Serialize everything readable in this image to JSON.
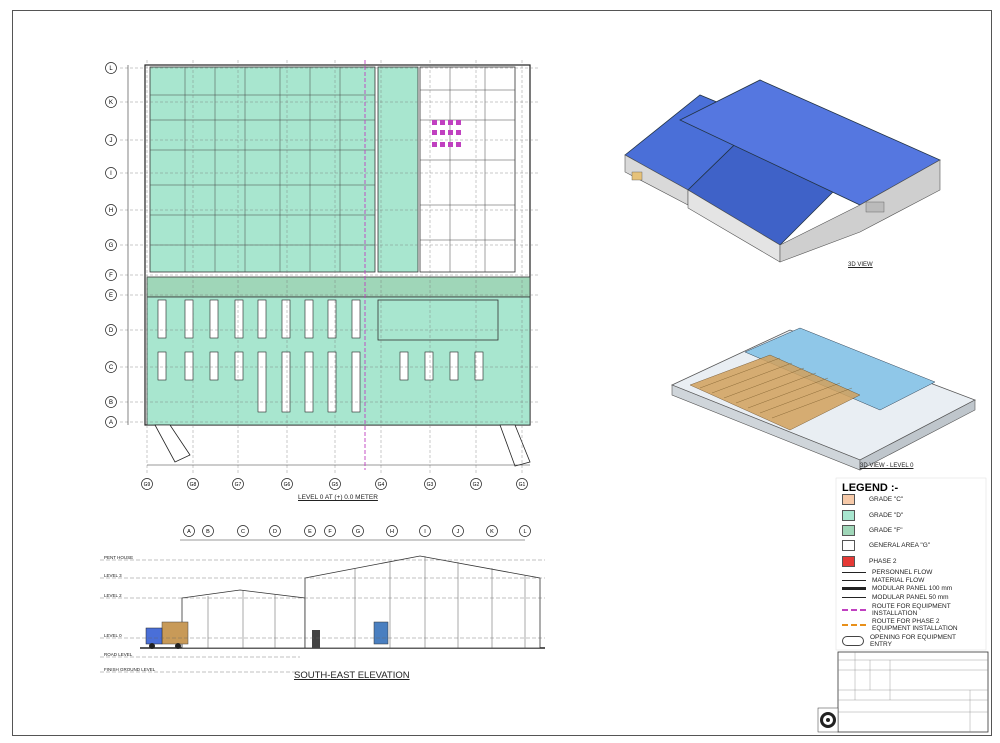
{
  "views": {
    "plan_title": "LEVEL 0 AT (+) 0.0 METER",
    "elevation_title": "SOUTH-EAST ELEVATION",
    "view_3d_title": "3D VIEW",
    "view_3d_level0_title": "3D VIEW - LEVEL 0"
  },
  "grid": {
    "rows": [
      "L",
      "K",
      "J",
      "I",
      "H",
      "G",
      "F",
      "E",
      "D",
      "C",
      "B",
      "A"
    ],
    "cols": [
      "G9",
      "G8",
      "G7",
      "G6",
      "G5",
      "G4",
      "G3",
      "G2",
      "G1"
    ],
    "elev_cols": [
      "A",
      "B",
      "C",
      "D",
      "E",
      "F",
      "G",
      "H",
      "I",
      "J",
      "K",
      "L"
    ]
  },
  "elevation_levels": [
    {
      "name": "PENT HOUSE"
    },
    {
      "name": "LEVEL 3"
    },
    {
      "name": "LEVEL 2"
    },
    {
      "name": "LEVEL 0"
    },
    {
      "name": "ROAD LEVEL"
    },
    {
      "name": "FINISH GROUND LEVEL"
    }
  ],
  "legend": {
    "title": "LEGEND :-",
    "fills": [
      {
        "label": "GRADE \"C\"",
        "color": "#f6c9a8"
      },
      {
        "label": "GRADE \"D\"",
        "color": "#a8e6cf"
      },
      {
        "label": "GRADE \"F\"",
        "color": "#9fd6b8"
      },
      {
        "label": "GENERAL AREA \"G\"",
        "color": "#ffffff"
      },
      {
        "label": "PHASE 2",
        "color": "#e53935"
      }
    ],
    "lines": [
      {
        "label": "PERSONNEL FLOW",
        "style": "arrow"
      },
      {
        "label": "MATERIAL FLOW",
        "style": "arrow"
      },
      {
        "label": "MODULAR PANEL 100 mm",
        "style": "thick"
      },
      {
        "label": "MODULAR PANEL 50 mm",
        "style": "thin"
      },
      {
        "label": "ROUTE FOR EQUIPMENT INSTALLATION",
        "style": "dash-magenta"
      },
      {
        "label": "ROUTE FOR PHASE 2 EQUIPMENT INSTALLATION",
        "style": "dash-orange"
      },
      {
        "label": "OPENING FOR EQUIPMENT ENTRY",
        "style": "cloud"
      }
    ]
  },
  "colors": {
    "clean_area": "#a8e6cf",
    "roof_blue": "#4a6fd8",
    "wall_grey": "#d9d9d9",
    "cargo": "#d2a15c"
  }
}
